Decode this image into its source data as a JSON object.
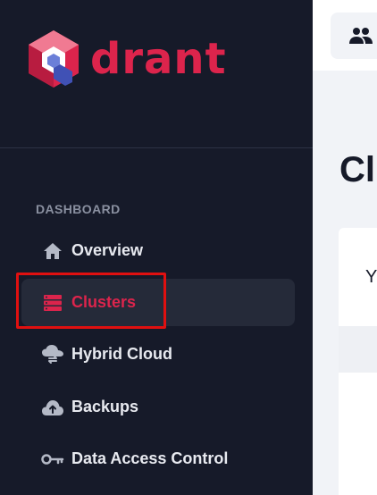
{
  "brand": {
    "name": "drant",
    "color": "#dc244c"
  },
  "sidebar": {
    "section_label": "DASHBOARD",
    "items": [
      {
        "label": "Overview",
        "icon": "home-icon",
        "active": false
      },
      {
        "label": "Clusters",
        "icon": "clusters-icon",
        "active": true
      },
      {
        "label": "Hybrid Cloud",
        "icon": "hybrid-cloud-icon",
        "active": false
      },
      {
        "label": "Backups",
        "icon": "cloud-upload-icon",
        "active": false
      },
      {
        "label": "Data Access Control",
        "icon": "key-icon",
        "active": false
      }
    ]
  },
  "main": {
    "page_title": "Clu",
    "card_text": "Y"
  },
  "colors": {
    "sidebar_bg": "#161a29",
    "accent": "#dc244c",
    "highlight": "#e01010"
  }
}
